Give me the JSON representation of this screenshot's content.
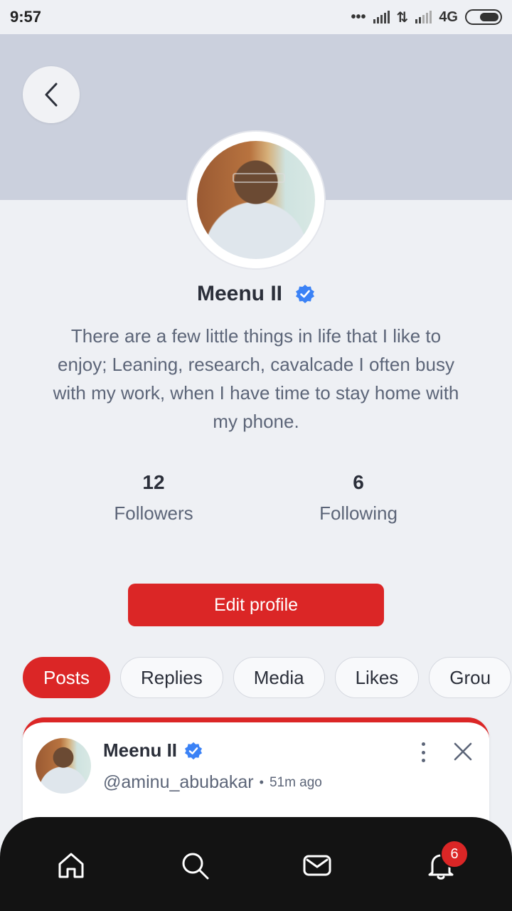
{
  "status_bar": {
    "time": "9:57",
    "network": "4G"
  },
  "profile": {
    "name": "Meenu II",
    "bio": "There are a few little things in life that I like to enjoy; Leaning, research, cavalcade I often busy with my work, when I have time to stay home with my phone.",
    "followers_count": "12",
    "followers_label": "Followers",
    "following_count": "6",
    "following_label": "Following",
    "edit_button": "Edit profile"
  },
  "tabs": [
    "Posts",
    "Replies",
    "Media",
    "Likes",
    "Grou"
  ],
  "post": {
    "author": "Meenu II",
    "handle": "@aminu_abubakar",
    "separator": "•",
    "time_ago": "51m ago"
  },
  "bottom_nav": {
    "items": [
      "home-icon",
      "search-icon",
      "mail-icon",
      "bell-icon"
    ],
    "notification_badge": "6"
  },
  "colors": {
    "accent": "#db2626",
    "cover": "#cbd0dd",
    "verified": "#3b82f6",
    "nav_background": "#131313"
  }
}
